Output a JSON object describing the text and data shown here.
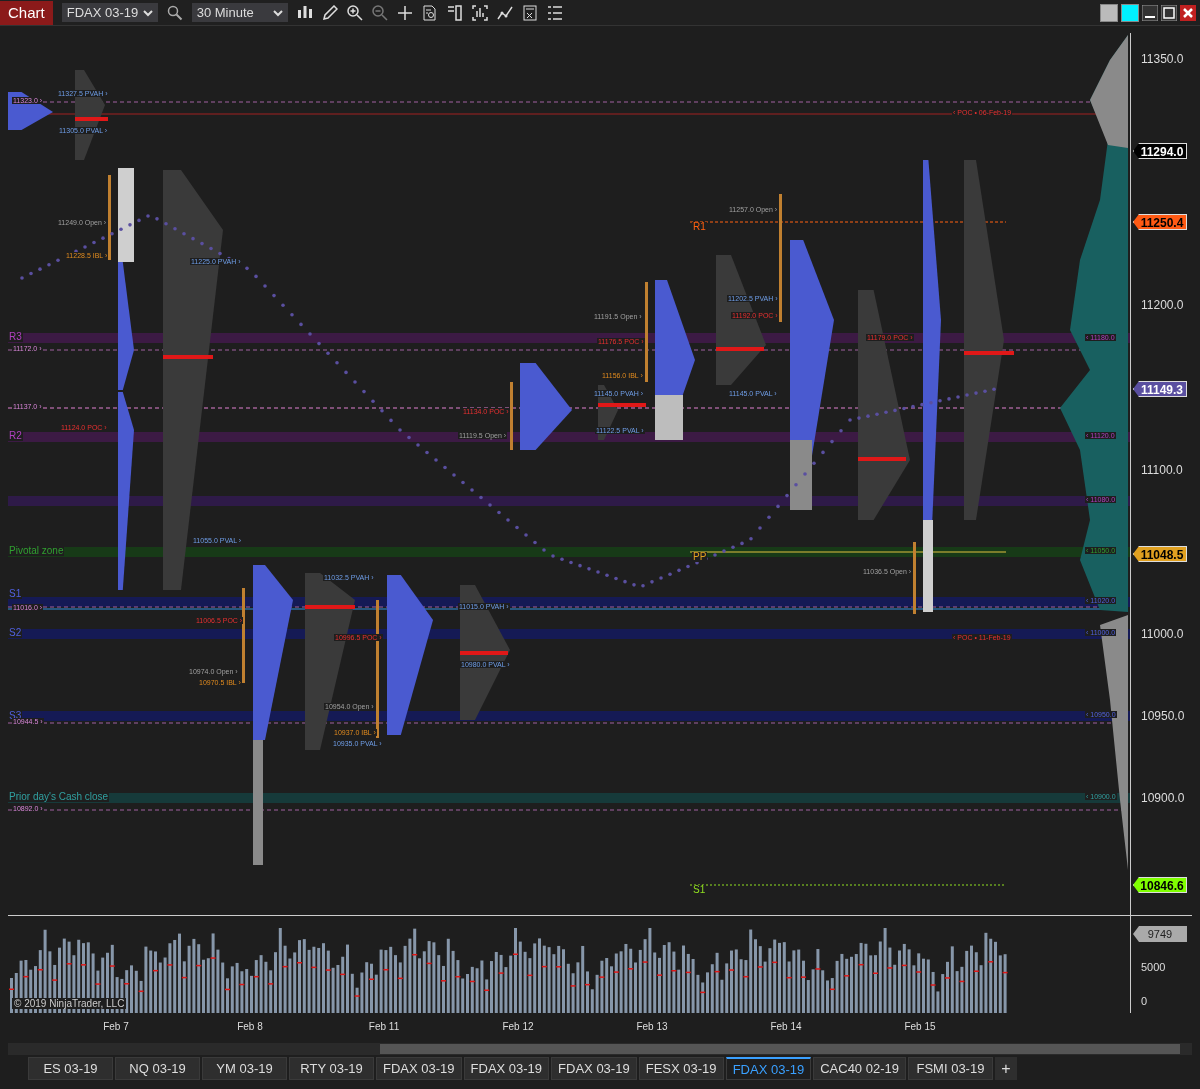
{
  "toolbar": {
    "title": "Chart",
    "instrument": "FDAX 03-19",
    "interval": "30 Minute"
  },
  "chart": {
    "labels": [
      {
        "text": "11327.5 PVAH ›",
        "kind": "pvah"
      },
      {
        "text": "11323.0 ›",
        "kind": "level"
      },
      {
        "text": "11305.0 PVAL ›",
        "kind": "pval"
      },
      {
        "text": "11249.0 Open ›",
        "kind": "open"
      },
      {
        "text": "11228.5 IBL ›",
        "kind": "ibl"
      },
      {
        "text": "11225.0 PVAH ›",
        "kind": "pvah"
      },
      {
        "text": "R3",
        "kind": "resistance"
      },
      {
        "text": "11172.0 ›",
        "kind": "level"
      },
      {
        "text": "11137.0 ›",
        "kind": "level"
      },
      {
        "text": "11124.0 POC ›",
        "kind": "poc"
      },
      {
        "text": "R2",
        "kind": "resistance"
      },
      {
        "text": "Pivotal zone",
        "kind": "pivot"
      },
      {
        "text": "11055.0 PVAL ›",
        "kind": "pval"
      },
      {
        "text": "R1",
        "kind": "r1"
      },
      {
        "text": "11257.0 Open ›",
        "kind": "open"
      },
      {
        "text": "11202.5 PVAH ›",
        "kind": "pvah"
      },
      {
        "text": "11192.0 POC ›",
        "kind": "poc"
      },
      {
        "text": "11191.5 Open ›",
        "kind": "open"
      },
      {
        "text": "11176.5 POC ›",
        "kind": "poc"
      },
      {
        "text": "11179.0 POC ›",
        "kind": "poc"
      },
      {
        "text": "11156.0 IBL ›",
        "kind": "ibl"
      },
      {
        "text": "11145.0 PVAH ›",
        "kind": "pvah"
      },
      {
        "text": "11145.0 PVAL ›",
        "kind": "pval"
      },
      {
        "text": "11134.0 POC ›",
        "kind": "poc"
      },
      {
        "text": "11119.5 Open ›",
        "kind": "open"
      },
      {
        "text": "11122.5 PVAL ›",
        "kind": "pval"
      },
      {
        "text": "PP",
        "kind": "pp"
      },
      {
        "text": "S1",
        "kind": "support"
      },
      {
        "text": "11016.0 ›",
        "kind": "level"
      },
      {
        "text": "S2",
        "kind": "support"
      },
      {
        "text": "11006.5 POC ›",
        "kind": "poc"
      },
      {
        "text": "11032.5 PVAH ›",
        "kind": "pvah"
      },
      {
        "text": "11015.0 PVAH ›",
        "kind": "pvah"
      },
      {
        "text": "10996.5 POC ›",
        "kind": "poc"
      },
      {
        "text": "10980.0 PVAL ›",
        "kind": "pval"
      },
      {
        "text": "10974.0 Open ›",
        "kind": "open"
      },
      {
        "text": "10970.5 IBL ›",
        "kind": "ibl"
      },
      {
        "text": "10954.0 Open ›",
        "kind": "open"
      },
      {
        "text": "S3",
        "kind": "support"
      },
      {
        "text": "10944.5 ›",
        "kind": "level"
      },
      {
        "text": "10937.0 IBL ›",
        "kind": "ibl"
      },
      {
        "text": "10935.0 PVAL ›",
        "kind": "pval"
      },
      {
        "text": "Prior day's Cash close",
        "kind": "cash"
      },
      {
        "text": "10892.0 ›",
        "kind": "level"
      },
      {
        "text": "11036.5 Open ›",
        "kind": "open"
      },
      {
        "text": "‹ POC • 06-Feb-19",
        "kind": "poc"
      },
      {
        "text": "‹ POC • 11-Feb-19",
        "kind": "poc"
      },
      {
        "text": "S1",
        "kind": "s1"
      },
      {
        "text": "‹ 11180.0",
        "kind": "resistance"
      },
      {
        "text": "‹ 11120.0",
        "kind": "resistance"
      },
      {
        "text": "‹ 11080.0",
        "kind": "resistance"
      },
      {
        "text": "‹ 11050.0",
        "kind": "pivot"
      },
      {
        "text": "‹ 11020.0",
        "kind": "support"
      },
      {
        "text": "‹ 11000.0",
        "kind": "support"
      },
      {
        "text": "‹ 10950.0",
        "kind": "support"
      },
      {
        "text": "‹ 10900.0",
        "kind": "cash"
      }
    ],
    "price_axis": {
      "ticks": [
        "11350.0",
        "11200.0",
        "11100.0",
        "11000.0",
        "10950.0",
        "10900.0"
      ],
      "markers": [
        {
          "text": "11294.0",
          "color": "#000000"
        },
        {
          "text": "11250.4",
          "color": "#ff5a14"
        },
        {
          "text": "11149.3",
          "color": "#5a4fa0"
        },
        {
          "text": "11048.5",
          "color": "#e0a020"
        },
        {
          "text": "10846.6",
          "color": "#7fff00"
        }
      ]
    }
  },
  "volume": {
    "copyright": "© 2019 NinjaTrader, LLC",
    "marker": "9749",
    "ticks": [
      "5000",
      "0"
    ]
  },
  "dates": [
    "Feb 7",
    "Feb 8",
    "Feb 11",
    "Feb 12",
    "Feb 13",
    "Feb 14",
    "Feb 15"
  ],
  "tabs": [
    {
      "label": "ES 03-19",
      "selected": false
    },
    {
      "label": "NQ 03-19",
      "selected": false
    },
    {
      "label": "YM 03-19",
      "selected": false
    },
    {
      "label": "RTY 03-19",
      "selected": false
    },
    {
      "label": "FDAX 03-19",
      "selected": false
    },
    {
      "label": "FDAX 03-19",
      "selected": false
    },
    {
      "label": "FDAX 03-19",
      "selected": false
    },
    {
      "label": "FESX 03-19",
      "selected": false
    },
    {
      "label": "FDAX 03-19",
      "selected": true
    },
    {
      "label": "CAC40 02-19",
      "selected": false
    },
    {
      "label": "FSMI 03-19",
      "selected": false
    }
  ],
  "add_tab": "+"
}
